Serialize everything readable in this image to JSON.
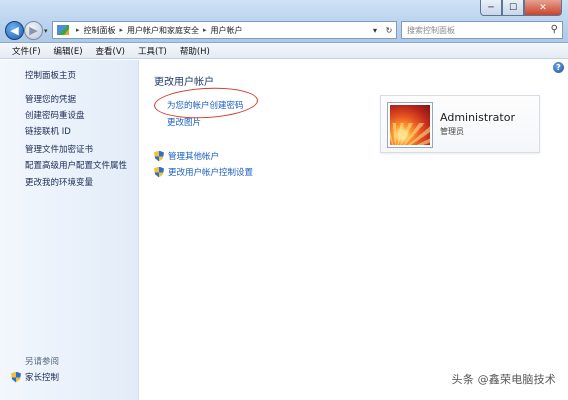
{
  "window": {
    "min": "─",
    "max": "☐",
    "close": "✕"
  },
  "address": {
    "crumbs": [
      "控制面板",
      "用户帐户和家庭安全",
      "用户帐户"
    ],
    "separator": "▸",
    "dropdown": "▾",
    "refresh": "↻"
  },
  "search": {
    "placeholder": "搜索控制面板",
    "icon": "search-icon"
  },
  "menu": [
    "文件(F)",
    "编辑(E)",
    "查看(V)",
    "工具(T)",
    "帮助(H)"
  ],
  "sidebar": {
    "items": [
      "控制面板主页",
      "管理您的凭据",
      "创建密码重设盘",
      "链接联机 ID",
      "管理文件加密证书",
      "配置高级用户配置文件属性",
      "更改我的环境变量"
    ],
    "see_also": "另请参阅",
    "family": "家长控制"
  },
  "main": {
    "heading": "更改用户帐户",
    "tasks": [
      "为您的帐户创建密码",
      "更改图片"
    ],
    "admin_tasks": [
      "管理其他帐户",
      "更改用户帐户控制设置"
    ],
    "help": "?"
  },
  "user": {
    "name": "Administrator",
    "role": "管理员"
  },
  "watermark": "头条 @鑫荣电脑技术",
  "colors": {
    "link": "#1a5ec2",
    "highlight": "#d33a2c"
  }
}
